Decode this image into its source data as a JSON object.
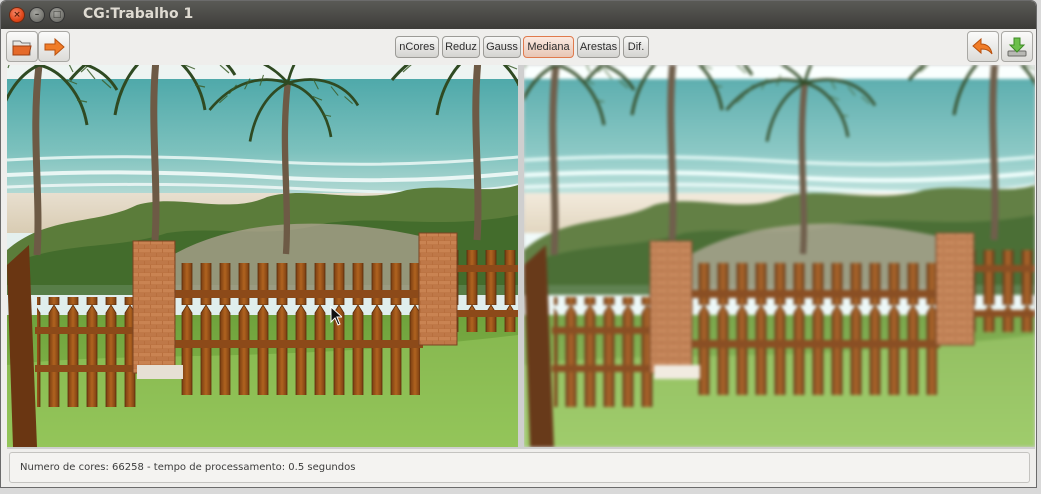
{
  "window": {
    "title": "CG:Trabalho 1",
    "close_glyph": "×",
    "minimize_glyph": "–",
    "maximize_glyph": "□"
  },
  "toolbar": {
    "left_icons": [
      "folder-open-icon",
      "arrow-right-icon"
    ],
    "filters": [
      {
        "label": "nCores",
        "active": false
      },
      {
        "label": "Reduz",
        "active": false
      },
      {
        "label": "Gauss",
        "active": false
      },
      {
        "label": "Mediana",
        "active": true
      },
      {
        "label": "Arestas",
        "active": false
      },
      {
        "label": "Dif.",
        "active": false
      }
    ],
    "right_icons": [
      "undo-arrow-icon",
      "download-save-icon"
    ]
  },
  "images": {
    "original": "beach-fence-photo-original",
    "processed": "beach-fence-photo-median-filtered"
  },
  "status": {
    "text": "Numero de cores: 66258 - tempo de processamento: 0.5 segundos"
  },
  "colors": {
    "accent_active": "#e07a4d",
    "titlebar": "#3d3c39"
  }
}
